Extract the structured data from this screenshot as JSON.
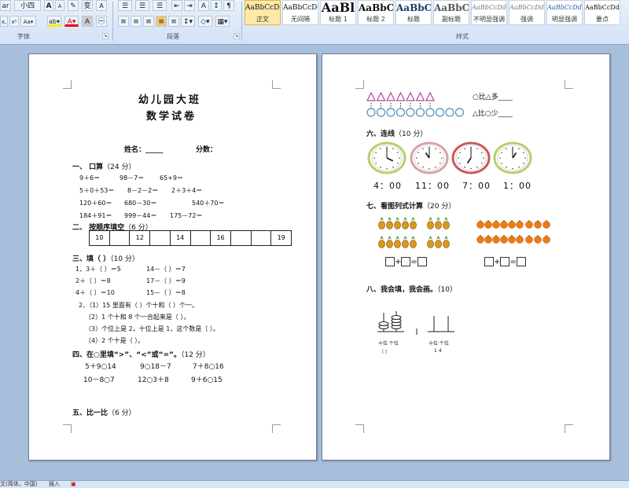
{
  "ribbon": {
    "font_group_label": "字体",
    "paragraph_group_label": "段落",
    "styles_group_label": "样式",
    "font_size": "小四",
    "font_name": "ar",
    "styles": [
      {
        "sample": "AaBbCcDc",
        "name": "正文",
        "active": true
      },
      {
        "sample": "AaBbCcDc",
        "name": "无间隔",
        "active": false
      },
      {
        "sample": "AaBl",
        "name": "标题 1",
        "active": false
      },
      {
        "sample": "AaBbC",
        "name": "标题 2",
        "active": false
      },
      {
        "sample": "AaBbC",
        "name": "标题",
        "active": false
      },
      {
        "sample": "AaBbC",
        "name": "副标题",
        "active": false
      },
      {
        "sample": "AaBbCcDd",
        "name": "不明显强调",
        "active": false
      },
      {
        "sample": "AaBbCcDd",
        "name": "强调",
        "active": false
      },
      {
        "sample": "AaBbCcDd",
        "name": "明显强调",
        "active": false
      },
      {
        "sample": "AaBbCcDd",
        "name": "要点",
        "active": false
      }
    ]
  },
  "page1": {
    "title1": "幼儿园大班",
    "title2": "数学试卷",
    "name_label": "姓名：_____",
    "score_label": "分数：",
    "s1_title": "一、  口算",
    "s1_points": "（24 分）",
    "s1_rows": [
      [
        "9＋6＝",
        "98－7＝",
        "65+9＝"
      ],
      [
        "5＋0＋53＝",
        "8－2－2＝",
        "2＋3＋4＝"
      ],
      [
        "120＋60＝",
        "680－30＝",
        "540＋70＝"
      ],
      [
        "184＋91＝",
        "999－44＝",
        "175－72＝"
      ]
    ],
    "s2_title": "二、  按顺序填空",
    "s2_points": "（6 分）",
    "s2_cells": [
      "10",
      "",
      "12",
      "",
      "14",
      "",
      "16",
      "",
      "",
      "19"
    ],
    "s3_title": "三、填（   ）",
    "s3_points": "（10 分）",
    "s3_rows": [
      [
        "1、3＋（   ）＝5",
        "14－（   ）＝7"
      ],
      [
        "2＋（   ）＝8",
        "17－（   ）＝9"
      ],
      [
        "4＋（   ）＝10",
        "15－（   ）＝8"
      ]
    ],
    "s3_lines": [
      "2、（1）15 里面有（  ）个十和（  ）个一。",
      "（2）1 个十和 8 个一合起来是（    ）。",
      "（3）个位上是 2，十位上是 1，这个数是（     ）。",
      "（4）2 个十是（     ）。"
    ],
    "s4_title": "四、在○里填“>”、“<”或“=”。",
    "s4_points": "（12 分）",
    "s4_rows": [
      [
        "5＋9○14",
        "9○18－7",
        "7＋8○16"
      ],
      [
        "10－8○7",
        "12○3＋8",
        "9＋6○15"
      ]
    ],
    "s5_title": "五、比一比",
    "s5_points": "（6 分）"
  },
  "page2": {
    "compare1": "○比△多____",
    "compare2": "△比○少____",
    "s6_title": "六、连线",
    "s6_points": "（10 分）",
    "times": [
      "4：00",
      "11：00",
      "7：00",
      "1：00"
    ],
    "s7_title": "七、看图列式计算",
    "s7_points": "（20 分）",
    "eq_op1": "+",
    "eq_op2": "=",
    "s8_title": "八、我会填，我会画。",
    "s8_points": "（10）",
    "abacus_label1": "十位 个位",
    "abacus_paren": "（     ）",
    "abacus_label2": "十位 个位",
    "abacus_digits": "1    4"
  },
  "status": {
    "language": "文(简体，中国)",
    "mode": "插入"
  }
}
